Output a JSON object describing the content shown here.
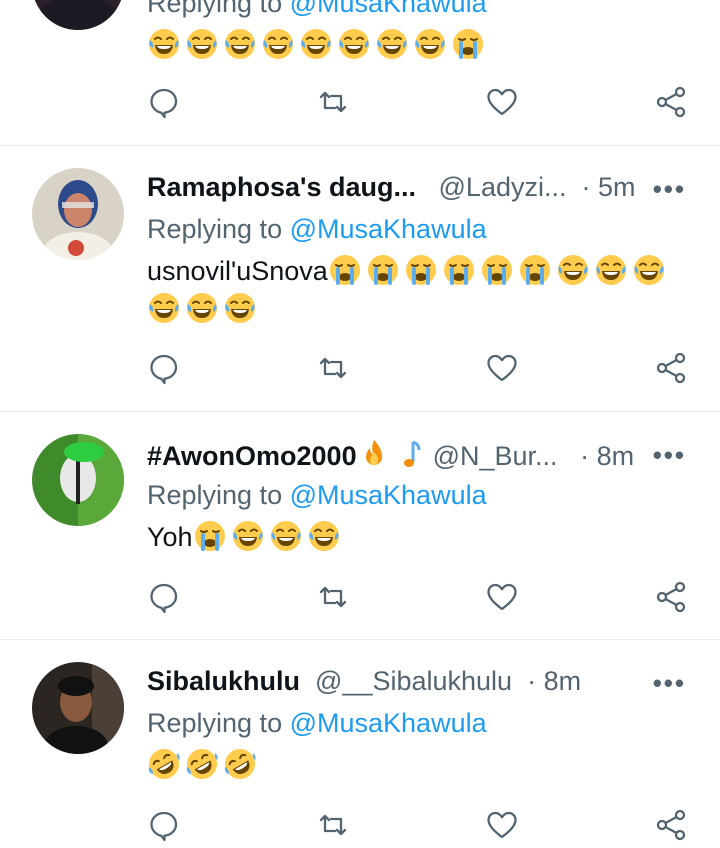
{
  "tweets": [
    {
      "name": "",
      "handle": "",
      "time": "",
      "replying_prefix": "Replying to ",
      "replying_to": "@MusaKhawula",
      "text_lines": [
        ""
      ],
      "emojis_line1": [
        "joy",
        "joy",
        "joy",
        "joy",
        "joy",
        "joy",
        "joy",
        "joy",
        "sob"
      ],
      "emojis_line2": []
    },
    {
      "name": "Ramaphosa's daug...",
      "handle": "@Ladyzi...",
      "time": "· 5m",
      "replying_prefix": "Replying to ",
      "replying_to": "@MusaKhawula",
      "text": "usnovil'uSnova",
      "emojis_line1": [
        "sob",
        "sob",
        "sob",
        "sob",
        "sob",
        "sob",
        "joy",
        "joy",
        "joy"
      ],
      "emojis_line2": [
        "joy",
        "joy",
        "joy"
      ]
    },
    {
      "name": "#AwonOmo2000",
      "handle": "@N_Bur...",
      "time": "· 8m",
      "replying_prefix": "Replying to ",
      "replying_to": "@MusaKhawula",
      "text": "Yoh",
      "name_emojis": [
        "fire",
        "music-note"
      ],
      "emojis_line1": [
        "sob",
        "joy",
        "joy",
        "joy"
      ]
    },
    {
      "name": "Sibalukhulu",
      "handle": "@__Sibalukhulu",
      "time": "· 8m",
      "replying_prefix": "Replying to ",
      "replying_to": "@MusaKhawula",
      "text": "",
      "emojis_line1": [
        "rofl",
        "rofl",
        "rofl"
      ]
    }
  ],
  "more_label": "•••",
  "colors": {
    "link": "#1d9bf0",
    "muted": "#536471",
    "text": "#0f1419",
    "divider": "#e8eaec",
    "emoji_face": "#ffcc4d"
  },
  "icons": [
    "reply-icon",
    "retweet-icon",
    "like-icon",
    "share-icon"
  ]
}
